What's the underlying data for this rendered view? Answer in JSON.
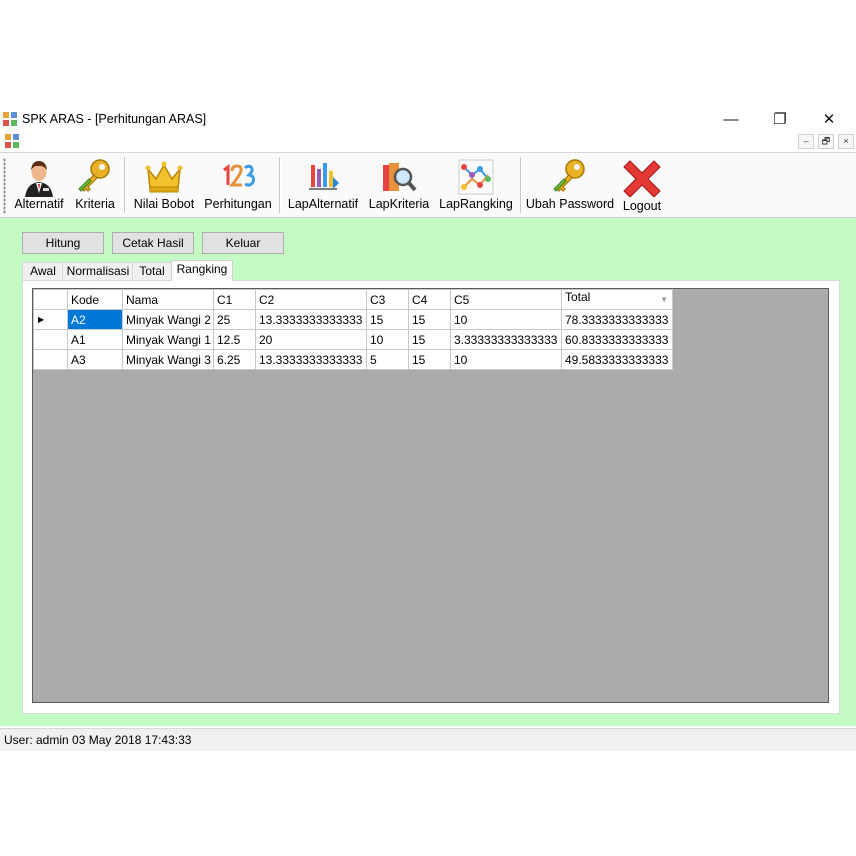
{
  "window": {
    "title": "SPK ARAS - [Perhitungan ARAS]",
    "minimize": "—",
    "restore": "❐",
    "close": "✕"
  },
  "mdi": {
    "minimize": "–",
    "restore": "🗗",
    "close": "×"
  },
  "toolbar": {
    "items": [
      {
        "label": "Alternatif",
        "icon": "person-icon"
      },
      {
        "label": "Kriteria",
        "icon": "keys-icon"
      },
      {
        "label": "Nilai Bobot",
        "icon": "crown-icon"
      },
      {
        "label": "Perhitungan",
        "icon": "numbers-123-icon"
      },
      {
        "label": "LapAlternatif",
        "icon": "report-icon"
      },
      {
        "label": "LapKriteria",
        "icon": "magnifier-book-icon"
      },
      {
        "label": "LapRangking",
        "icon": "network-graph-icon"
      },
      {
        "label": "Ubah Password",
        "icon": "key-icon"
      },
      {
        "label": "Logout",
        "icon": "red-x-icon"
      }
    ]
  },
  "actions": {
    "hitung": "Hitung",
    "cetak": "Cetak Hasil",
    "keluar": "Keluar"
  },
  "tabs": [
    "Awal",
    "Normalisasi",
    "Total",
    "Rangking"
  ],
  "active_tab": "Rangking",
  "grid": {
    "columns": [
      "Kode",
      "Nama",
      "C1",
      "C2",
      "C3",
      "C4",
      "C5",
      "Total"
    ],
    "rows": [
      [
        "A2",
        "Minyak Wangi 2",
        "25",
        "13.3333333333333",
        "15",
        "15",
        "10",
        "78.3333333333333"
      ],
      [
        "A1",
        "Minyak Wangi 1",
        "12.5",
        "20",
        "10",
        "15",
        "3.33333333333333",
        "60.8333333333333"
      ],
      [
        "A3",
        "Minyak Wangi 3",
        "6.25",
        "13.3333333333333",
        "5",
        "15",
        "10",
        "49.5833333333333"
      ]
    ]
  },
  "status": {
    "text": "User: admin  03 May 2018 17:43:33"
  },
  "colors": {
    "client_bg": "#c4fbc4",
    "grid_bg": "#ababab",
    "selection": "#0078d7"
  }
}
